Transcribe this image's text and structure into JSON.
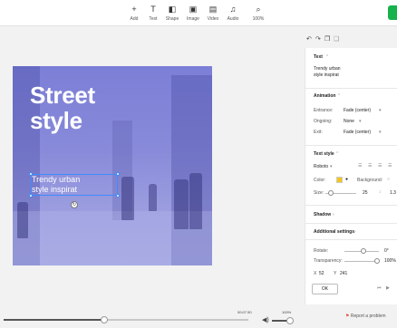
{
  "toolbar": {
    "items": [
      {
        "label": "Add",
        "icon": "plus-icon",
        "glyph": "+"
      },
      {
        "label": "Text",
        "icon": "text-icon",
        "glyph": "T"
      },
      {
        "label": "Shape",
        "icon": "shape-icon",
        "glyph": "◧"
      },
      {
        "label": "Image",
        "icon": "image-icon",
        "glyph": "▣"
      },
      {
        "label": "Video",
        "icon": "video-icon",
        "glyph": "▤"
      },
      {
        "label": "Audio",
        "icon": "audio-icon",
        "glyph": "♫"
      },
      {
        "label": "100%",
        "icon": "zoom-icon",
        "glyph": "⌕"
      }
    ],
    "export_color": "#16b24c"
  },
  "canvas": {
    "headline_line1": "Street",
    "headline_line2": "style",
    "subtext_line1": "Trendy urban",
    "subtext_line2": "style inspirat",
    "overlay_color": "#7c7fd6"
  },
  "timeline": {
    "total_time": "00:07.50",
    "progress": 0.41,
    "volume_label": "100%",
    "volume": 1.0
  },
  "panel": {
    "text_section": {
      "title": "Text",
      "value_line1": "Trendy urban",
      "value_line2": "style inspirat"
    },
    "animation": {
      "title": "Animation",
      "entrance_label": "Entrance:",
      "entrance_value": "Fade (center)",
      "ongoing_label": "Ongoing:",
      "ongoing_value": "None",
      "exit_label": "Exit:",
      "exit_value": "Fade (center)"
    },
    "text_style": {
      "title": "Text style",
      "font": "Roboto",
      "color_label": "Color:",
      "color_value": "#f5c518",
      "background_label": "Background:",
      "size_label": "Size:",
      "size_value": "25",
      "line_height_value": "1.3"
    },
    "shadow_title": "Shadow",
    "additional": {
      "title": "Additional settings",
      "rotate_label": "Rotate:",
      "rotate_value": "0°",
      "transparency_label": "Transparency:",
      "transparency_value": "100%",
      "x_label": "X",
      "x_value": "52",
      "y_label": "Y",
      "y_value": "241"
    },
    "ok_label": "OK"
  },
  "report_label": "Report a problem"
}
